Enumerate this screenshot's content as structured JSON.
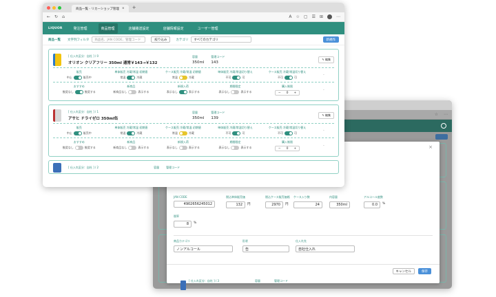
{
  "colors": {
    "teal": "#2f8f7f",
    "toggle_on": "#2f8f7f",
    "toggle_off": "#c8c8c8",
    "toggle_yellow": "#e6c52c",
    "primary": "#4a90d9"
  },
  "browser": {
    "tab_title": "商品一覧 - リカーショップ管理"
  },
  "nav": {
    "logo": "LIQUOR",
    "items": [
      "発注管理",
      "商品管理",
      "店舗播送設定",
      "店舗情報設定",
      "ユーザー管理"
    ]
  },
  "filter": {
    "title": "商品一覧",
    "text_filter_label": "文字列フィルタ",
    "text_filter_placeholder": "商品名、JAN CODE、管理コード",
    "narrow_button": "絞り込み",
    "category_label": "カテゴリ",
    "category_value": "すべてのカテゴリ",
    "new_button": "新規作"
  },
  "labels": {
    "capacity": "容量",
    "code": "管理コード",
    "edit": "編集",
    "sale": "販売",
    "bottle_sale": "単体販売 冷蔵/常温 初期値",
    "case_sale": "ケース販売 冷蔵/常温 初期値",
    "bottle_switch": "単体販売 冷蔵/常温切り替え",
    "case_switch": "ケース販売 冷蔵/常温切り替え",
    "recommend": "おすすめ",
    "new_item": "新商品",
    "restock": "新規入荷",
    "limited": "期間限定",
    "qty_limit": "購入制限"
  },
  "products": [
    {
      "sub": "[ 仕入れ区分：自社 ] / 0",
      "name": "オリオン クリアフリー 350ml 通常￥143→￥132",
      "capacity": "350ml",
      "code": "143",
      "sale": [
        "中止",
        "販売中"
      ],
      "bottle": [
        "常温",
        "冷蔵"
      ],
      "case": [
        "常温",
        "冷蔵"
      ],
      "bswitch": [
        "不可",
        "可"
      ],
      "cswitch": [
        "不可",
        "可"
      ],
      "rec": [
        "推奨なし",
        "推奨する"
      ],
      "newitem": [
        "新商品なし",
        "表示する"
      ],
      "restock": [
        "表示なし",
        "表示する"
      ],
      "limited": [
        "表示なし",
        "表示する"
      ],
      "qty": "0"
    },
    {
      "sub": "[ 仕入れ区分：自社 ] / 1",
      "name": "アサヒ ドライゼロ 350ml缶",
      "capacity": "350ml",
      "code": "139",
      "sale": [
        "中止",
        "販売中"
      ],
      "bottle": [
        "常温",
        "冷蔵"
      ],
      "case": [
        "常温",
        "冷蔵"
      ],
      "bswitch": [
        "不可",
        "可"
      ],
      "cswitch": [
        "不可",
        "可"
      ],
      "rec": [
        "推奨なし",
        "推奨する"
      ],
      "newitem": [
        "新商品なし",
        "表示する"
      ],
      "restock": [
        "表示なし",
        "表示する"
      ],
      "limited": [
        "表示なし",
        "表示する"
      ],
      "qty": "0"
    }
  ],
  "third_product": {
    "sub": "[ 仕入れ区分：自社 ] / 2",
    "capacity": "容量",
    "code": "管理コード"
  },
  "modal": {
    "jan_label": "JAN CODE",
    "jan": "4902656245012",
    "bottle_price_label": "税込単体販売価",
    "bottle_price": "132",
    "yen": "円",
    "case_price_label": "税込ケース販売価格",
    "case_price": "2970",
    "case_qty_label": "ケース入り数",
    "case_qty": "24",
    "volume_label": "内容量",
    "volume": "350ml",
    "alcohol_label": "アルコール度数",
    "alcohol": "0.0",
    "percent": "%",
    "tax_label": "税率",
    "tax": "8",
    "category_label": "商品カテゴリ",
    "category": "ノンアルコール",
    "shape_label": "形状",
    "shape": "缶",
    "supplier_label": "仕入れ先",
    "supplier": "自社仕入れ",
    "cancel": "キャンセル",
    "save": "保存",
    "close": "×"
  },
  "bottom_peek": {
    "sub": "[ 仕入れ区分：自社 ] / 3",
    "capacity": "容量",
    "code": "管理コード"
  }
}
